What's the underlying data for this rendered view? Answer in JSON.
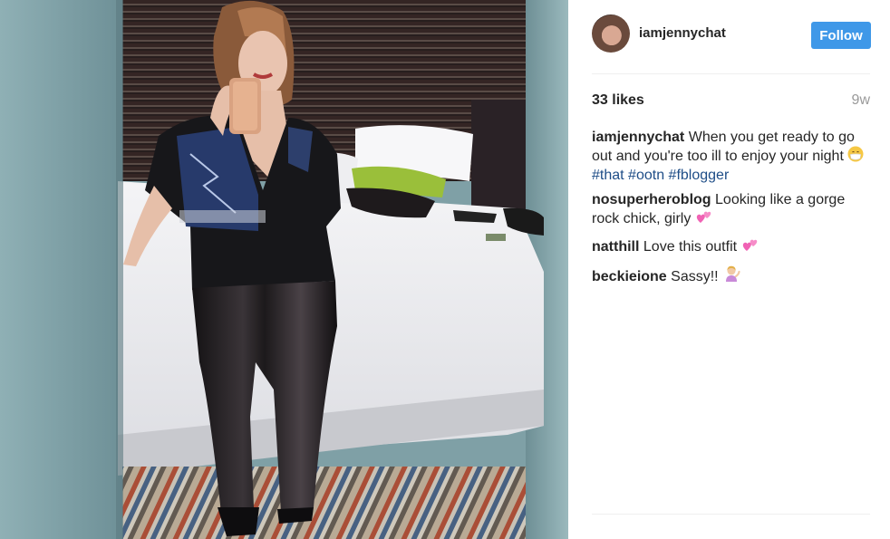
{
  "post": {
    "username": "iamjennychat",
    "follow_label": "Follow",
    "likes": "33 likes",
    "age": "9w",
    "caption": {
      "author": "iamjennychat",
      "text": "When you get ready to go out and you're too ill to enjoy your night",
      "hashtags": [
        "#that",
        "#ootn",
        "#fblogger"
      ]
    },
    "comments": [
      {
        "author": "nosuperheroblog",
        "text": "Looking like a gorge rock chick, girly",
        "emoji": "sparkling-heart-icon"
      },
      {
        "author": "natthill",
        "text": "Love this outfit",
        "emoji": "sparkling-heart-icon"
      },
      {
        "author": "beckieione",
        "text": "Sassy!!",
        "emoji": "person-tipping-hand-icon"
      }
    ]
  },
  "colors": {
    "follow_button": "#3f98e8",
    "hashtag": "#1e4d87",
    "muted": "#9a9a9a"
  }
}
